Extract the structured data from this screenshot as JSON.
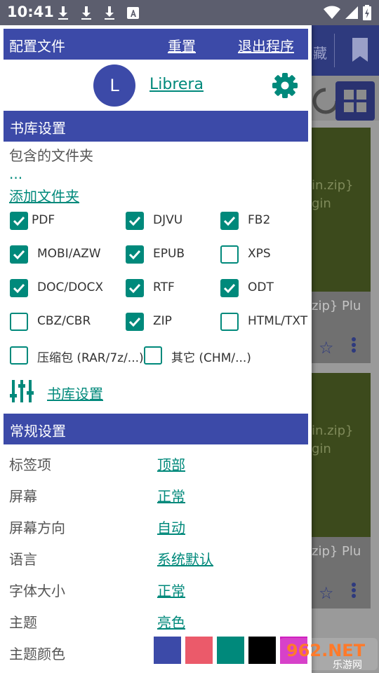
{
  "status_bar": {
    "time": "10:41",
    "icons": [
      "download-icon",
      "download-icon",
      "download-icon",
      "font-a-icon",
      "wifi-icon",
      "signal-icon",
      "battery-icon"
    ]
  },
  "background": {
    "tab_text": "藏",
    "card1": {
      "cover_line1": "in.zip}",
      "cover_line2": "gin",
      "title": "zip} Plu"
    },
    "card2": {
      "cover_line1": "in.zip}",
      "cover_line2": "gin",
      "title": "zip} Plu"
    }
  },
  "drawer": {
    "header": {
      "title": "配置文件",
      "reset": "重置",
      "exit": "退出程序"
    },
    "profile": {
      "avatar_letter": "L",
      "name": "Librera"
    },
    "library_section": {
      "title": "书库设置",
      "folders_label": "包含的文件夹",
      "folders_value": "...",
      "add_folder": "添加文件夹",
      "formats": [
        {
          "label": "PDF",
          "checked": true
        },
        {
          "label": "DJVU",
          "checked": true
        },
        {
          "label": "FB2",
          "checked": true
        },
        {
          "label": "MOBI/AZW",
          "checked": true
        },
        {
          "label": "EPUB",
          "checked": true
        },
        {
          "label": "XPS",
          "checked": false
        },
        {
          "label": "DOC/DOCX",
          "checked": true
        },
        {
          "label": "RTF",
          "checked": true
        },
        {
          "label": "ODT",
          "checked": true
        },
        {
          "label": "CBZ/CBR",
          "checked": false
        },
        {
          "label": "ZIP",
          "checked": true
        },
        {
          "label": "HTML/TXT",
          "checked": false
        },
        {
          "label": "压缩包 (RAR/7z/...)",
          "checked": false
        },
        {
          "label": "其它 (CHM/...)",
          "checked": false
        }
      ],
      "settings_link": "书库设置"
    },
    "general_section": {
      "title": "常规设置",
      "rows": [
        {
          "label": "标签项",
          "value": "顶部"
        },
        {
          "label": "屏幕",
          "value": "正常"
        },
        {
          "label": "屏幕方向",
          "value": "自动"
        },
        {
          "label": "语言",
          "value": "系统默认"
        },
        {
          "label": "字体大小",
          "value": "正常"
        },
        {
          "label": "主题",
          "value": "亮色"
        },
        {
          "label": "主题颜色",
          "value": ""
        }
      ],
      "theme_colors": [
        "#3c4aa8",
        "#eb5a6a",
        "#00897b",
        "#000000",
        "#d020c0"
      ]
    }
  },
  "watermark": {
    "brand": "962.NET",
    "sub": "乐游网"
  }
}
